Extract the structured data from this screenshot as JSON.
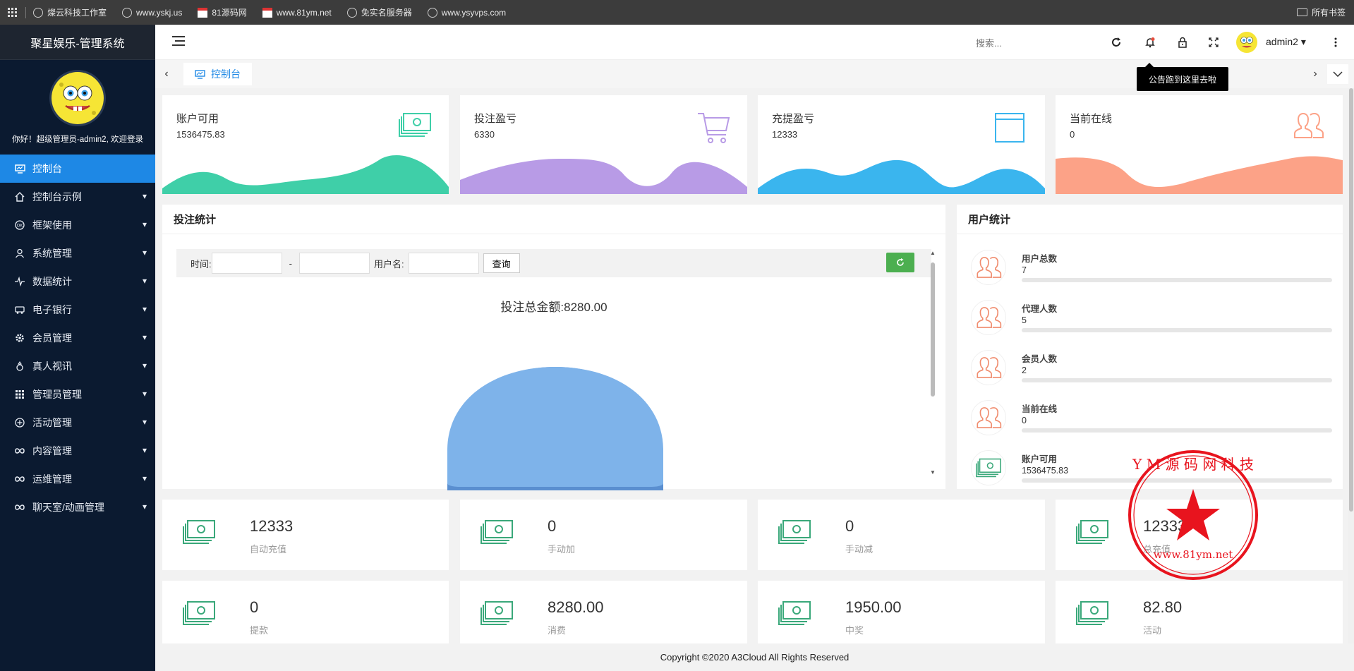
{
  "bookmarks": {
    "items": [
      {
        "label": "燦云科技工作室",
        "icon": "globe-icon"
      },
      {
        "label": "www.yskj.us",
        "icon": "globe-icon"
      },
      {
        "label": "81源码网",
        "icon": "site-icon"
      },
      {
        "label": "www.81ym.net",
        "icon": "site-icon"
      },
      {
        "label": "免实名服务器",
        "icon": "globe-icon"
      },
      {
        "label": "www.ysyvps.com",
        "icon": "globe-icon"
      }
    ],
    "all_bookmarks": "所有书签"
  },
  "sidebar": {
    "title": "聚星娱乐-管理系统",
    "welcome": "你好！超级管理员-admin2, 欢迎登录",
    "items": [
      {
        "label": "控制台",
        "active": true
      },
      {
        "label": "控制台示例"
      },
      {
        "label": "框架使用"
      },
      {
        "label": "系统管理"
      },
      {
        "label": "数据统计"
      },
      {
        "label": "电子银行"
      },
      {
        "label": "会员管理"
      },
      {
        "label": "真人视讯"
      },
      {
        "label": "管理员管理"
      },
      {
        "label": "活动管理"
      },
      {
        "label": "内容管理"
      },
      {
        "label": "运维管理"
      },
      {
        "label": "聊天室/动画管理"
      }
    ]
  },
  "header": {
    "search_placeholder": "搜索...",
    "username": "admin2",
    "tooltip": "公告跑到这里去啦"
  },
  "tabs": {
    "active": "控制台"
  },
  "stats": [
    {
      "title": "账户可用",
      "value": "1536475.83",
      "color": "#3fcfa8"
    },
    {
      "title": "投注盈亏",
      "value": "6330",
      "color": "#b89be6"
    },
    {
      "title": "充提盈亏",
      "value": "12333",
      "color": "#3ab5ee"
    },
    {
      "title": "当前在线",
      "value": "0",
      "color": "#fca287"
    }
  ],
  "bet_panel": {
    "title": "投注统计",
    "time_label": "时间:",
    "dash": "-",
    "user_label": "用户名:",
    "query_button": "查询",
    "pie_title": "投注总金额:8280.00"
  },
  "user_panel": {
    "title": "用户统计",
    "rows": [
      {
        "label": "用户总数",
        "value": "7"
      },
      {
        "label": "代理人数",
        "value": "5"
      },
      {
        "label": "会员人数",
        "value": "2"
      },
      {
        "label": "当前在线",
        "value": "0"
      },
      {
        "label": "账户可用",
        "value": "1536475.83"
      }
    ]
  },
  "bottom_cards": [
    {
      "value": "12333",
      "label": "自动充值"
    },
    {
      "value": "0",
      "label": "手动加"
    },
    {
      "value": "0",
      "label": "手动减"
    },
    {
      "value": "12333",
      "label": "总充值"
    },
    {
      "value": "0",
      "label": "提款"
    },
    {
      "value": "8280.00",
      "label": "消费"
    },
    {
      "value": "1950.00",
      "label": "中奖"
    },
    {
      "value": "82.80",
      "label": "活动"
    }
  ],
  "stamp": {
    "ring_text": "Y M 源 码 网 科 技",
    "url": "www.81ym.net"
  },
  "footer": {
    "copyright": "Copyright ©2020 A3Cloud All Rights Reserved"
  },
  "colors": {
    "sidebar_bg": "#0b1a30",
    "active": "#1e88e5",
    "icon_green": "#3aa87a",
    "icon_orange": "#f08c6e",
    "stamp_red": "#e8141e"
  }
}
